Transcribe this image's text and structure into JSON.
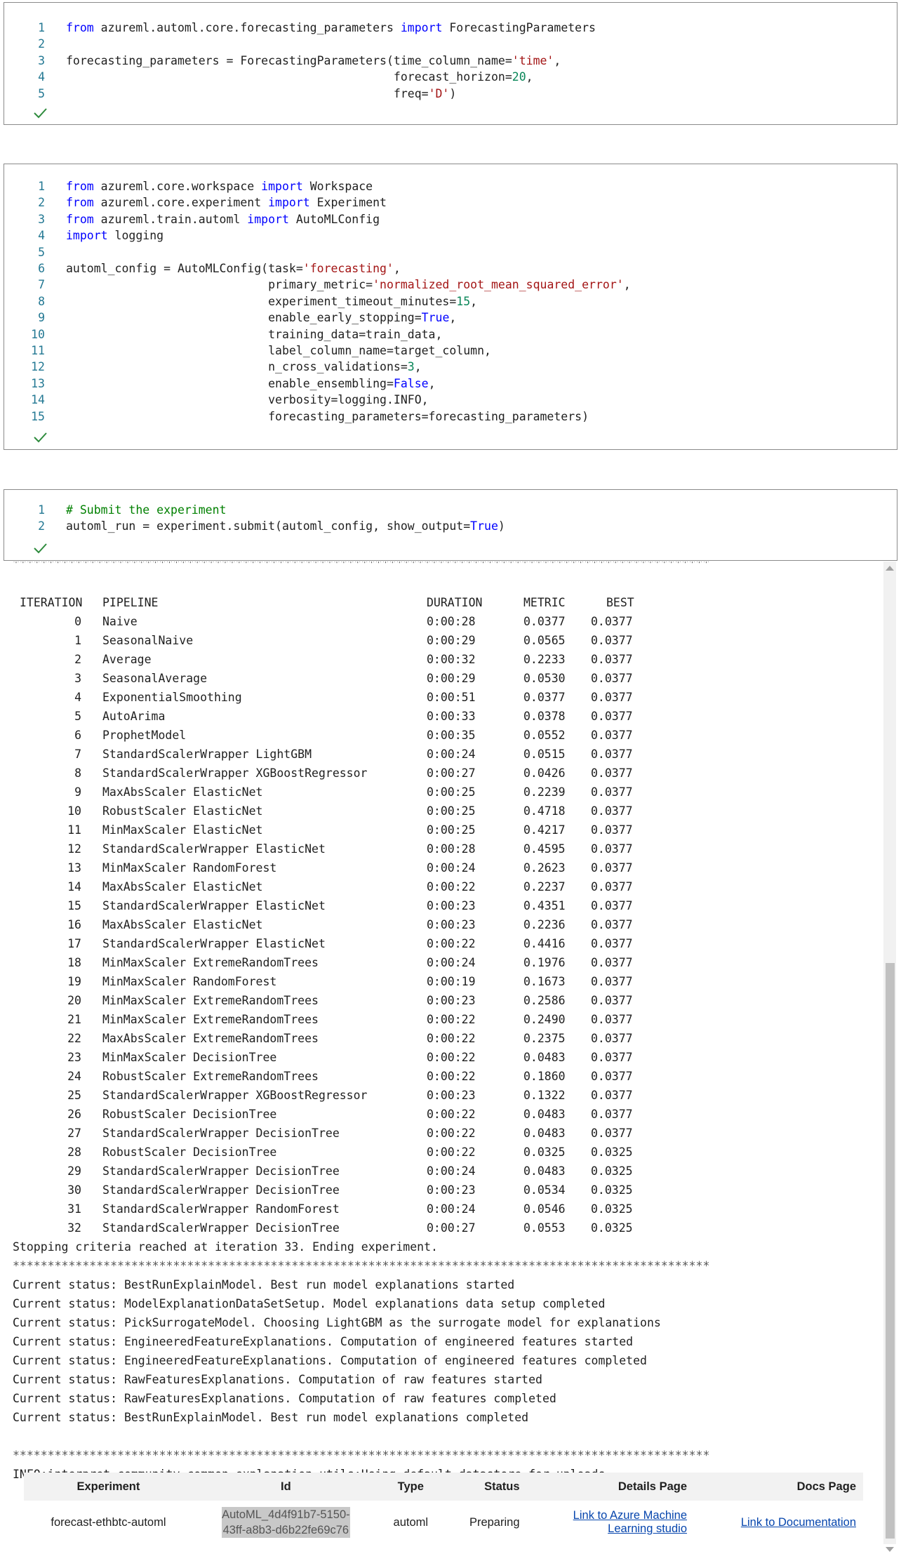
{
  "cells": [
    {
      "lines": [
        [
          {
            "t": "from ",
            "c": "kw"
          },
          {
            "t": "azureml.automl.core.forecasting_parameters "
          },
          {
            "t": "import",
            "c": "kw"
          },
          {
            "t": " ForecastingParameters"
          }
        ],
        [],
        [
          {
            "t": "forecasting_parameters = ForecastingParameters(time_column_name="
          },
          {
            "t": "'time'",
            "c": "str"
          },
          {
            "t": ","
          }
        ],
        [
          {
            "t": "                                               forecast_horizon="
          },
          {
            "t": "20",
            "c": "num"
          },
          {
            "t": ","
          }
        ],
        [
          {
            "t": "                                               freq="
          },
          {
            "t": "'D'",
            "c": "str"
          },
          {
            "t": ")"
          }
        ]
      ]
    },
    {
      "lines": [
        [
          {
            "t": "from",
            "c": "kw"
          },
          {
            "t": " azureml.core.workspace "
          },
          {
            "t": "import",
            "c": "kw"
          },
          {
            "t": " Workspace"
          }
        ],
        [
          {
            "t": "from",
            "c": "kw"
          },
          {
            "t": " azureml.core.experiment "
          },
          {
            "t": "import",
            "c": "kw"
          },
          {
            "t": " Experiment"
          }
        ],
        [
          {
            "t": "from",
            "c": "kw"
          },
          {
            "t": " azureml.train.automl "
          },
          {
            "t": "import",
            "c": "kw"
          },
          {
            "t": " AutoMLConfig"
          }
        ],
        [
          {
            "t": "import",
            "c": "kw"
          },
          {
            "t": " logging"
          }
        ],
        [],
        [
          {
            "t": "automl_config = AutoMLConfig(task="
          },
          {
            "t": "'forecasting'",
            "c": "str"
          },
          {
            "t": ","
          }
        ],
        [
          {
            "t": "                             primary_metric="
          },
          {
            "t": "'normalized_root_mean_squared_error'",
            "c": "str"
          },
          {
            "t": ","
          }
        ],
        [
          {
            "t": "                             experiment_timeout_minutes="
          },
          {
            "t": "15",
            "c": "num"
          },
          {
            "t": ","
          }
        ],
        [
          {
            "t": "                             enable_early_stopping="
          },
          {
            "t": "True",
            "c": "kw"
          },
          {
            "t": ","
          }
        ],
        [
          {
            "t": "                             training_data=train_data,"
          }
        ],
        [
          {
            "t": "                             label_column_name=target_column,"
          }
        ],
        [
          {
            "t": "                             n_cross_validations="
          },
          {
            "t": "3",
            "c": "num"
          },
          {
            "t": ","
          }
        ],
        [
          {
            "t": "                             enable_ensembling="
          },
          {
            "t": "False",
            "c": "kw"
          },
          {
            "t": ","
          }
        ],
        [
          {
            "t": "                             verbosity=logging.INFO,"
          }
        ],
        [
          {
            "t": "                             forecasting_parameters=forecasting_parameters)"
          }
        ]
      ]
    },
    {
      "lines": [
        [
          {
            "t": "# Submit the experiment",
            "c": "cmt"
          }
        ],
        [
          {
            "t": "automl_run = experiment.submit(automl_config, show_output="
          },
          {
            "t": "True",
            "c": "kw"
          },
          {
            "t": ")"
          }
        ]
      ]
    }
  ],
  "output": {
    "stars": "****************************************************************************************************",
    "headers": {
      "iteration": "ITERATION",
      "pipeline": "PIPELINE",
      "duration": "DURATION",
      "metric": "METRIC",
      "best": "BEST"
    },
    "iterations": [
      [
        "0",
        "Naive",
        "0:00:28",
        "0.0377",
        "0.0377"
      ],
      [
        "1",
        "SeasonalNaive",
        "0:00:29",
        "0.0565",
        "0.0377"
      ],
      [
        "2",
        "Average",
        "0:00:32",
        "0.2233",
        "0.0377"
      ],
      [
        "3",
        "SeasonalAverage",
        "0:00:29",
        "0.0530",
        "0.0377"
      ],
      [
        "4",
        "ExponentialSmoothing",
        "0:00:51",
        "0.0377",
        "0.0377"
      ],
      [
        "5",
        "AutoArima",
        "0:00:33",
        "0.0378",
        "0.0377"
      ],
      [
        "6",
        "ProphetModel",
        "0:00:35",
        "0.0552",
        "0.0377"
      ],
      [
        "7",
        "StandardScalerWrapper LightGBM",
        "0:00:24",
        "0.0515",
        "0.0377"
      ],
      [
        "8",
        "StandardScalerWrapper XGBoostRegressor",
        "0:00:27",
        "0.0426",
        "0.0377"
      ],
      [
        "9",
        "MaxAbsScaler ElasticNet",
        "0:00:25",
        "0.2239",
        "0.0377"
      ],
      [
        "10",
        "RobustScaler ElasticNet",
        "0:00:25",
        "0.4718",
        "0.0377"
      ],
      [
        "11",
        "MinMaxScaler ElasticNet",
        "0:00:25",
        "0.4217",
        "0.0377"
      ],
      [
        "12",
        "StandardScalerWrapper ElasticNet",
        "0:00:28",
        "0.4595",
        "0.0377"
      ],
      [
        "13",
        "MinMaxScaler RandomForest",
        "0:00:24",
        "0.2623",
        "0.0377"
      ],
      [
        "14",
        "MaxAbsScaler ElasticNet",
        "0:00:22",
        "0.2237",
        "0.0377"
      ],
      [
        "15",
        "StandardScalerWrapper ElasticNet",
        "0:00:23",
        "0.4351",
        "0.0377"
      ],
      [
        "16",
        "MaxAbsScaler ElasticNet",
        "0:00:23",
        "0.2236",
        "0.0377"
      ],
      [
        "17",
        "StandardScalerWrapper ElasticNet",
        "0:00:22",
        "0.4416",
        "0.0377"
      ],
      [
        "18",
        "MinMaxScaler ExtremeRandomTrees",
        "0:00:24",
        "0.1976",
        "0.0377"
      ],
      [
        "19",
        "MinMaxScaler RandomForest",
        "0:00:19",
        "0.1673",
        "0.0377"
      ],
      [
        "20",
        "MinMaxScaler ExtremeRandomTrees",
        "0:00:23",
        "0.2586",
        "0.0377"
      ],
      [
        "21",
        "MinMaxScaler ExtremeRandomTrees",
        "0:00:22",
        "0.2490",
        "0.0377"
      ],
      [
        "22",
        "MaxAbsScaler ExtremeRandomTrees",
        "0:00:22",
        "0.2375",
        "0.0377"
      ],
      [
        "23",
        "MinMaxScaler DecisionTree",
        "0:00:22",
        "0.0483",
        "0.0377"
      ],
      [
        "24",
        "RobustScaler ExtremeRandomTrees",
        "0:00:22",
        "0.1860",
        "0.0377"
      ],
      [
        "25",
        "StandardScalerWrapper XGBoostRegressor",
        "0:00:23",
        "0.1322",
        "0.0377"
      ],
      [
        "26",
        "RobustScaler DecisionTree",
        "0:00:22",
        "0.0483",
        "0.0377"
      ],
      [
        "27",
        "StandardScalerWrapper DecisionTree",
        "0:00:22",
        "0.0483",
        "0.0377"
      ],
      [
        "28",
        "RobustScaler DecisionTree",
        "0:00:22",
        "0.0325",
        "0.0325"
      ],
      [
        "29",
        "StandardScalerWrapper DecisionTree",
        "0:00:24",
        "0.0483",
        "0.0325"
      ],
      [
        "30",
        "StandardScalerWrapper DecisionTree",
        "0:00:23",
        "0.0534",
        "0.0325"
      ],
      [
        "31",
        "StandardScalerWrapper RandomForest",
        "0:00:24",
        "0.0546",
        "0.0325"
      ],
      [
        "32",
        "StandardScalerWrapper DecisionTree",
        "0:00:27",
        "0.0553",
        "0.0325"
      ]
    ],
    "stopping": "Stopping criteria reached at iteration 33. Ending experiment.",
    "statuses": [
      "Current status: BestRunExplainModel. Best run model explanations started",
      "Current status: ModelExplanationDataSetSetup. Model explanations data setup completed",
      "Current status: PickSurrogateModel. Choosing LightGBM as the surrogate model for explanations",
      "Current status: EngineeredFeatureExplanations. Computation of engineered features started",
      "Current status: EngineeredFeatureExplanations. Computation of engineered features completed",
      "Current status: RawFeaturesExplanations. Computation of raw features started",
      "Current status: RawFeaturesExplanations. Computation of raw features completed",
      "Current status: BestRunExplainModel. Best run model explanations completed"
    ],
    "info": "INFO:interpret_community.common.explanation_utils:Using default datastore for uploads"
  },
  "run_table": {
    "headers": {
      "experiment": "Experiment",
      "id": "Id",
      "type": "Type",
      "status": "Status",
      "details": "Details Page",
      "docs": "Docs Page"
    },
    "row": {
      "experiment": "forecast-ethbtc-automl",
      "id_line1": "AutoML_4d4f91b7-5150-",
      "id_line2": "43ff-a8b3-d6b22fe69c76",
      "type": "automl",
      "status": "Preparing",
      "details_line1": "Link to Azure Machine",
      "details_line2": "Learning studio",
      "docs": "Link to Documentation"
    }
  }
}
